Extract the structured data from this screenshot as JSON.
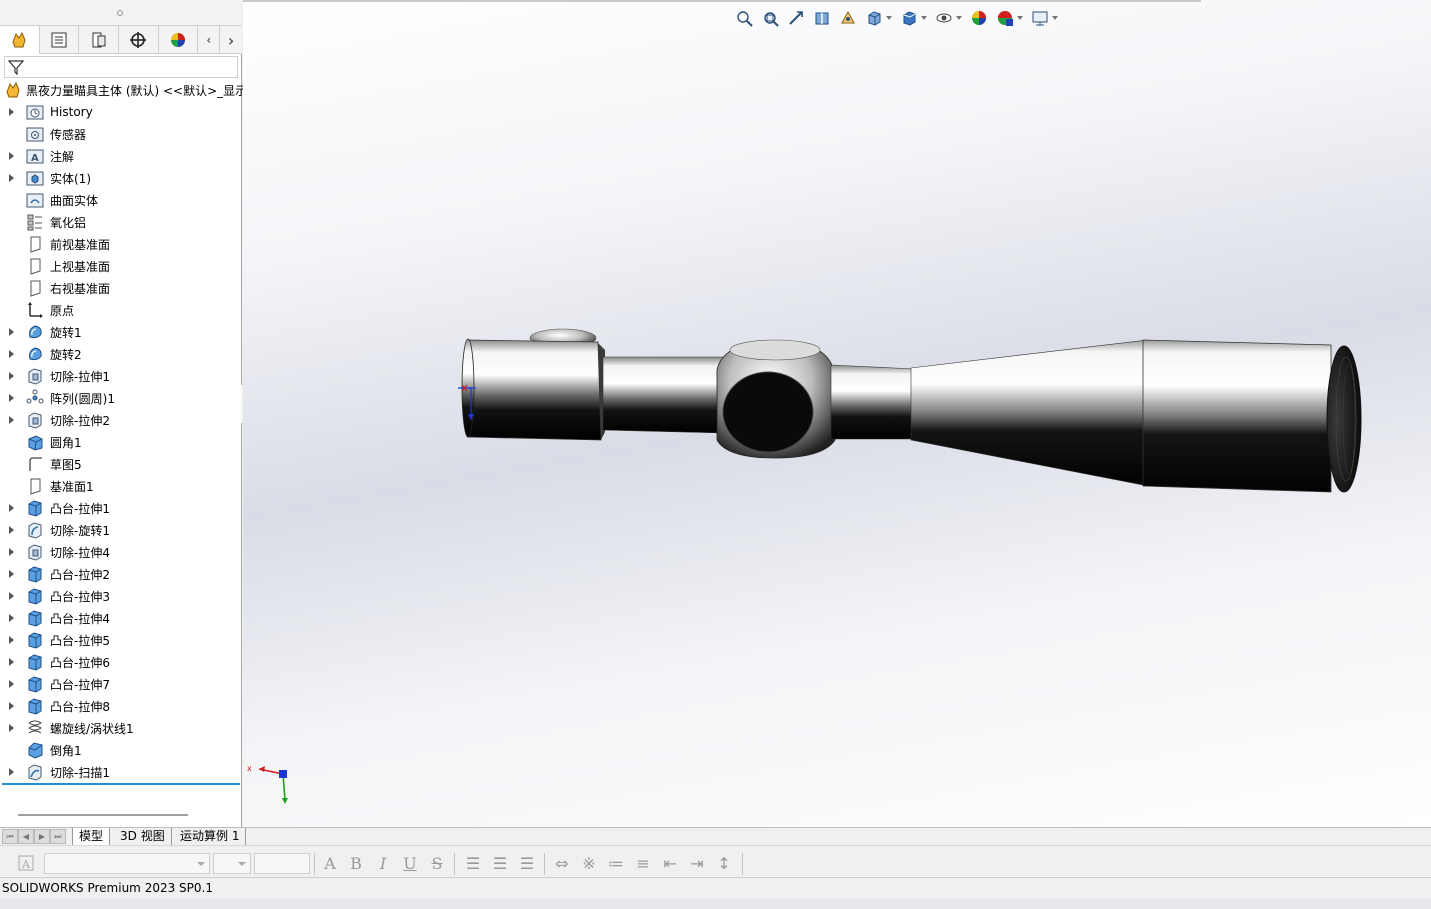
{
  "feature_manager": {
    "tabs": [
      {
        "name": "featuremanager-tab",
        "icon": "part-icon"
      },
      {
        "name": "propertymanager-tab",
        "icon": "property-list-icon"
      },
      {
        "name": "configurationmanager-tab",
        "icon": "configuration-icon"
      },
      {
        "name": "dimxpert-tab",
        "icon": "crosshair-icon"
      },
      {
        "name": "displaymanager-tab",
        "icon": "appearance-sphere-icon"
      }
    ],
    "filter_icon": "funnel-filter-icon",
    "root": {
      "label": "黑夜力量瞄具主体 (默认) <<默认>_显示",
      "icon": "part-icon"
    },
    "items": [
      {
        "label": "History",
        "icon": "history-folder-icon",
        "expandable": true
      },
      {
        "label": "传感器",
        "icon": "sensor-folder-icon",
        "expandable": false
      },
      {
        "label": "注解",
        "icon": "annotation-folder-icon",
        "expandable": true
      },
      {
        "label": "实体(1)",
        "icon": "solid-bodies-folder-icon",
        "expandable": true
      },
      {
        "label": "曲面实体",
        "icon": "surface-bodies-folder-icon",
        "expandable": false
      },
      {
        "label": "氧化铝",
        "icon": "material-icon",
        "expandable": false
      },
      {
        "label": "前视基准面",
        "icon": "plane-icon",
        "expandable": false
      },
      {
        "label": "上视基准面",
        "icon": "plane-icon",
        "expandable": false
      },
      {
        "label": "右视基准面",
        "icon": "plane-icon",
        "expandable": false
      },
      {
        "label": "原点",
        "icon": "origin-icon",
        "expandable": false
      },
      {
        "label": "旋转1",
        "icon": "revolve-icon",
        "expandable": true
      },
      {
        "label": "旋转2",
        "icon": "revolve-icon",
        "expandable": true
      },
      {
        "label": "切除-拉伸1",
        "icon": "cut-extrude-icon",
        "expandable": true
      },
      {
        "label": "阵列(圆周)1",
        "icon": "circular-pattern-icon",
        "expandable": true
      },
      {
        "label": "切除-拉伸2",
        "icon": "cut-extrude-icon",
        "expandable": true
      },
      {
        "label": "圆角1",
        "icon": "fillet-icon",
        "expandable": false
      },
      {
        "label": "草图5",
        "icon": "sketch-icon",
        "expandable": false
      },
      {
        "label": "基准面1",
        "icon": "plane-icon",
        "expandable": false
      },
      {
        "label": "凸台-拉伸1",
        "icon": "boss-extrude-icon",
        "expandable": true
      },
      {
        "label": "切除-旋转1",
        "icon": "cut-revolve-icon",
        "expandable": true
      },
      {
        "label": "切除-拉伸4",
        "icon": "cut-extrude-icon",
        "expandable": true
      },
      {
        "label": "凸台-拉伸2",
        "icon": "boss-extrude-icon",
        "expandable": true
      },
      {
        "label": "凸台-拉伸3",
        "icon": "boss-extrude-icon",
        "expandable": true
      },
      {
        "label": "凸台-拉伸4",
        "icon": "boss-extrude-icon",
        "expandable": true
      },
      {
        "label": "凸台-拉伸5",
        "icon": "boss-extrude-icon",
        "expandable": true
      },
      {
        "label": "凸台-拉伸6",
        "icon": "boss-extrude-icon",
        "expandable": true
      },
      {
        "label": "凸台-拉伸7",
        "icon": "boss-extrude-icon",
        "expandable": true
      },
      {
        "label": "凸台-拉伸8",
        "icon": "boss-extrude-icon",
        "expandable": true
      },
      {
        "label": "螺旋线/涡状线1",
        "icon": "helix-icon",
        "expandable": true
      },
      {
        "label": "倒角1",
        "icon": "chamfer-icon",
        "expandable": false
      },
      {
        "label": "切除-扫描1",
        "icon": "cut-sweep-icon",
        "expandable": true
      }
    ]
  },
  "heads_up_toolbar": [
    {
      "name": "zoom-to-fit-icon",
      "dropdown": false
    },
    {
      "name": "zoom-to-area-icon",
      "dropdown": false
    },
    {
      "name": "previous-view-icon",
      "dropdown": false
    },
    {
      "name": "section-view-icon",
      "dropdown": false
    },
    {
      "name": "dynamic-annotation-icon",
      "dropdown": false
    },
    {
      "name": "view-orientation-icon",
      "dropdown": true
    },
    {
      "name": "display-style-icon",
      "dropdown": true
    },
    {
      "name": "hide-show-items-icon",
      "dropdown": true
    },
    {
      "name": "edit-appearance-icon",
      "dropdown": false
    },
    {
      "name": "apply-scene-icon",
      "dropdown": true
    },
    {
      "name": "view-settings-icon",
      "dropdown": true
    }
  ],
  "sheet_tabs": [
    "模型",
    "3D 视图",
    "运动算例 1"
  ],
  "format_toolbar": {
    "text_style_icon": "text-style-icon",
    "bold": "B",
    "italic": "I",
    "underline": "U",
    "strike": "S"
  },
  "status_bar": {
    "text": "SOLIDWORKS Premium 2023 SP0.1"
  },
  "colors": {
    "accent_blue": "#1e8fd0",
    "panel_bg": "#ffffff",
    "chrome_bg": "#f0f0f0"
  }
}
